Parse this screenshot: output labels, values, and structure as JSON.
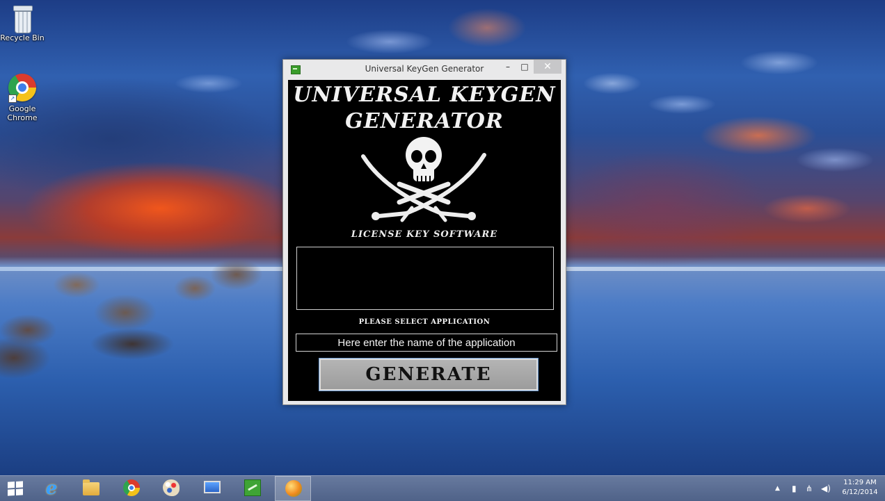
{
  "desktop": {
    "icons": [
      {
        "label": "Recycle Bin"
      },
      {
        "label_line1": "Google",
        "label_line2": "Chrome"
      }
    ]
  },
  "window": {
    "title": "Universal KeyGen Generator",
    "controls": {
      "minimize": "–",
      "maximize": "□",
      "close": "✕"
    },
    "brand_line1": "UNIVERSAL KEYGEN",
    "brand_line2": "GENERATOR",
    "subtitle": "LICENSE KEY SOFTWARE",
    "output_value": "",
    "select_label": "PLEASE SELECT APPLICATION",
    "app_input_placeholder": "Here enter the name of the application",
    "generate_label": "GENERATE"
  },
  "taskbar": {
    "items": [
      "start",
      "internet-explorer",
      "file-explorer",
      "chrome",
      "paint",
      "network",
      "keygen-app",
      "orange-app"
    ],
    "active_item": "orange-app",
    "tray": {
      "show_hidden": "▲",
      "time": "11:29 AM",
      "date": "6/12/2014"
    }
  },
  "colors": {
    "window_client": "#000000",
    "generate_button": "#a8a8a8",
    "taskbar": "#5a6e96"
  }
}
